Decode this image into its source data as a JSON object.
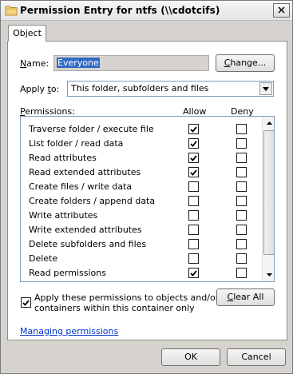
{
  "window": {
    "title": "Permission Entry for ntfs (\\\\cdotcifs)",
    "colors": {
      "chrome": "#d6d3ce",
      "selection": "#316ac5",
      "link": "#0033cc"
    },
    "icons": {
      "title": "folder-icon",
      "close": "close-icon"
    }
  },
  "tabs": [
    {
      "label": "Object",
      "active": true
    }
  ],
  "name_row": {
    "label": "Name:",
    "value": "Everyone",
    "change_button": "Change..."
  },
  "apply_row": {
    "label": "Apply to:",
    "selected": "This folder, subfolders and files"
  },
  "permissions": {
    "label": "Permissions:",
    "allow_header": "Allow",
    "deny_header": "Deny",
    "rows": [
      {
        "label": "Traverse folder / execute file",
        "allow": true,
        "deny": false
      },
      {
        "label": "List folder / read data",
        "allow": true,
        "deny": false
      },
      {
        "label": "Read attributes",
        "allow": true,
        "deny": false
      },
      {
        "label": "Read extended attributes",
        "allow": true,
        "deny": false
      },
      {
        "label": "Create files / write data",
        "allow": false,
        "deny": false
      },
      {
        "label": "Create folders / append data",
        "allow": false,
        "deny": false
      },
      {
        "label": "Write attributes",
        "allow": false,
        "deny": false
      },
      {
        "label": "Write extended attributes",
        "allow": false,
        "deny": false
      },
      {
        "label": "Delete subfolders and files",
        "allow": false,
        "deny": false
      },
      {
        "label": "Delete",
        "allow": false,
        "deny": false
      },
      {
        "label": "Read permissions",
        "allow": true,
        "deny": false
      }
    ]
  },
  "apply_inherit": {
    "checked": true,
    "line1": "Apply these permissions to objects and/or",
    "line2": "containers within this container only"
  },
  "clear_all_button": "Clear All",
  "help_link": "Managing permissions",
  "footer": {
    "ok": "OK",
    "cancel": "Cancel"
  }
}
